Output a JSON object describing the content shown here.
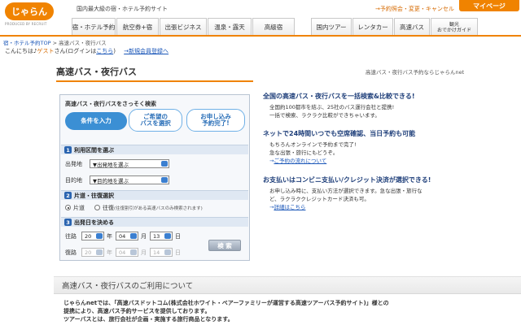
{
  "header": {
    "logo_text": "じゃらん",
    "logo_sub": "PRODUCED BY RECRUIT",
    "tagline": "国内最大級の宿・ホテル予約サイト",
    "top_link": "→予約照会・変更・キャンセル",
    "mypage_label": "マイページ",
    "nav_left": [
      "宿・ホテル予約",
      "航空券+宿",
      "出張ビジネス",
      "温泉・露天",
      "高級宿"
    ],
    "nav_right": [
      "国内ツアー",
      "レンタカー",
      "高速バス"
    ],
    "nav_last_line1": "観光",
    "nav_last_line2": "おでかけガイド"
  },
  "breadcrumb": {
    "home": "宿・ホテル予約TOP",
    "sep": " > ",
    "current": "高速バス・夜行バス"
  },
  "greeting": {
    "prefix": "こんにちは♪",
    "guest": "ゲスト",
    "mid": "さん(ログインは",
    "login_link": "こちら",
    "suffix": ")",
    "register_link": "→新規会員登録へ"
  },
  "page": {
    "title": "高速バス・夜行バス",
    "subtitle_right": "高速バス・夜行バス予約ならじゃらんnet"
  },
  "search": {
    "heading": "高速バス・夜行バスをさっそく検索",
    "step1": "条件を入力",
    "step2_line1": "ご希望の",
    "step2_line2": "バスを選択",
    "step3_line1": "お申し込み",
    "step3_line2": "予約完了!",
    "section1": "利用区間を選ぶ",
    "section1_num": "1",
    "departure_label": "出発地",
    "departure_value": "▼出発地を選ぶ",
    "destination_label": "目的地",
    "destination_value": "▼目的地を選ぶ",
    "section2": "片道・往復選択",
    "section2_num": "2",
    "oneway_label": "片道",
    "roundtrip_label": "往復",
    "roundtrip_note": "(往復割引がある高速バスのみ検索されます)",
    "section3": "出発日を決める",
    "section3_num": "3",
    "outbound_label": "往路",
    "outbound_year": "20",
    "outbound_month": "04",
    "outbound_day": "13",
    "return_label": "復路",
    "return_year": "20",
    "return_month": "04",
    "return_day": "14",
    "unit_year": "年",
    "unit_month": "月",
    "unit_day": "日",
    "search_button": "検 索"
  },
  "features": [
    {
      "title": "全国の高速バス・夜行バスを一括検索&比較できる!",
      "lines": [
        "全国約100都市を結ぶ、25社のバス運行会社と提携!",
        "一括で検索、ラクラク比較ができちゃいます。"
      ],
      "link": ""
    },
    {
      "title": "ネットで24時間いつでも空席確認、当日予約も可能",
      "lines": [
        "もちろんオンラインで予約まで完了!",
        "急な出張・旅行にもどうぞ。"
      ],
      "link": "ご予約の流れについて"
    },
    {
      "title": "お支払いはコンビニ支払い/クレジット決済が選択できる!",
      "lines": [
        "お申し込み時に、支払い方法が選択できます。急な出張・旅行な",
        "ど、ラクラククレジットカード決済も可。"
      ],
      "link": "詳細はこちら"
    }
  ],
  "about": {
    "heading": "高速バス・夜行バスのご利用について",
    "line1": "じゃらんnetでは、「高速バスドットコム(株式会社ホワイト・ベアーファミリーが運営する高速ツアーバス予約サイト)」様との",
    "line2": "提携により、高速バス予約サービスを提供しております。",
    "line3": "ツアーバスとは、旅行会社が企画・実施する旅行商品となります。"
  },
  "colors": {
    "brand_orange": "#f08300",
    "link_blue": "#1a56b8",
    "heading_navy": "#1f3f7a"
  }
}
